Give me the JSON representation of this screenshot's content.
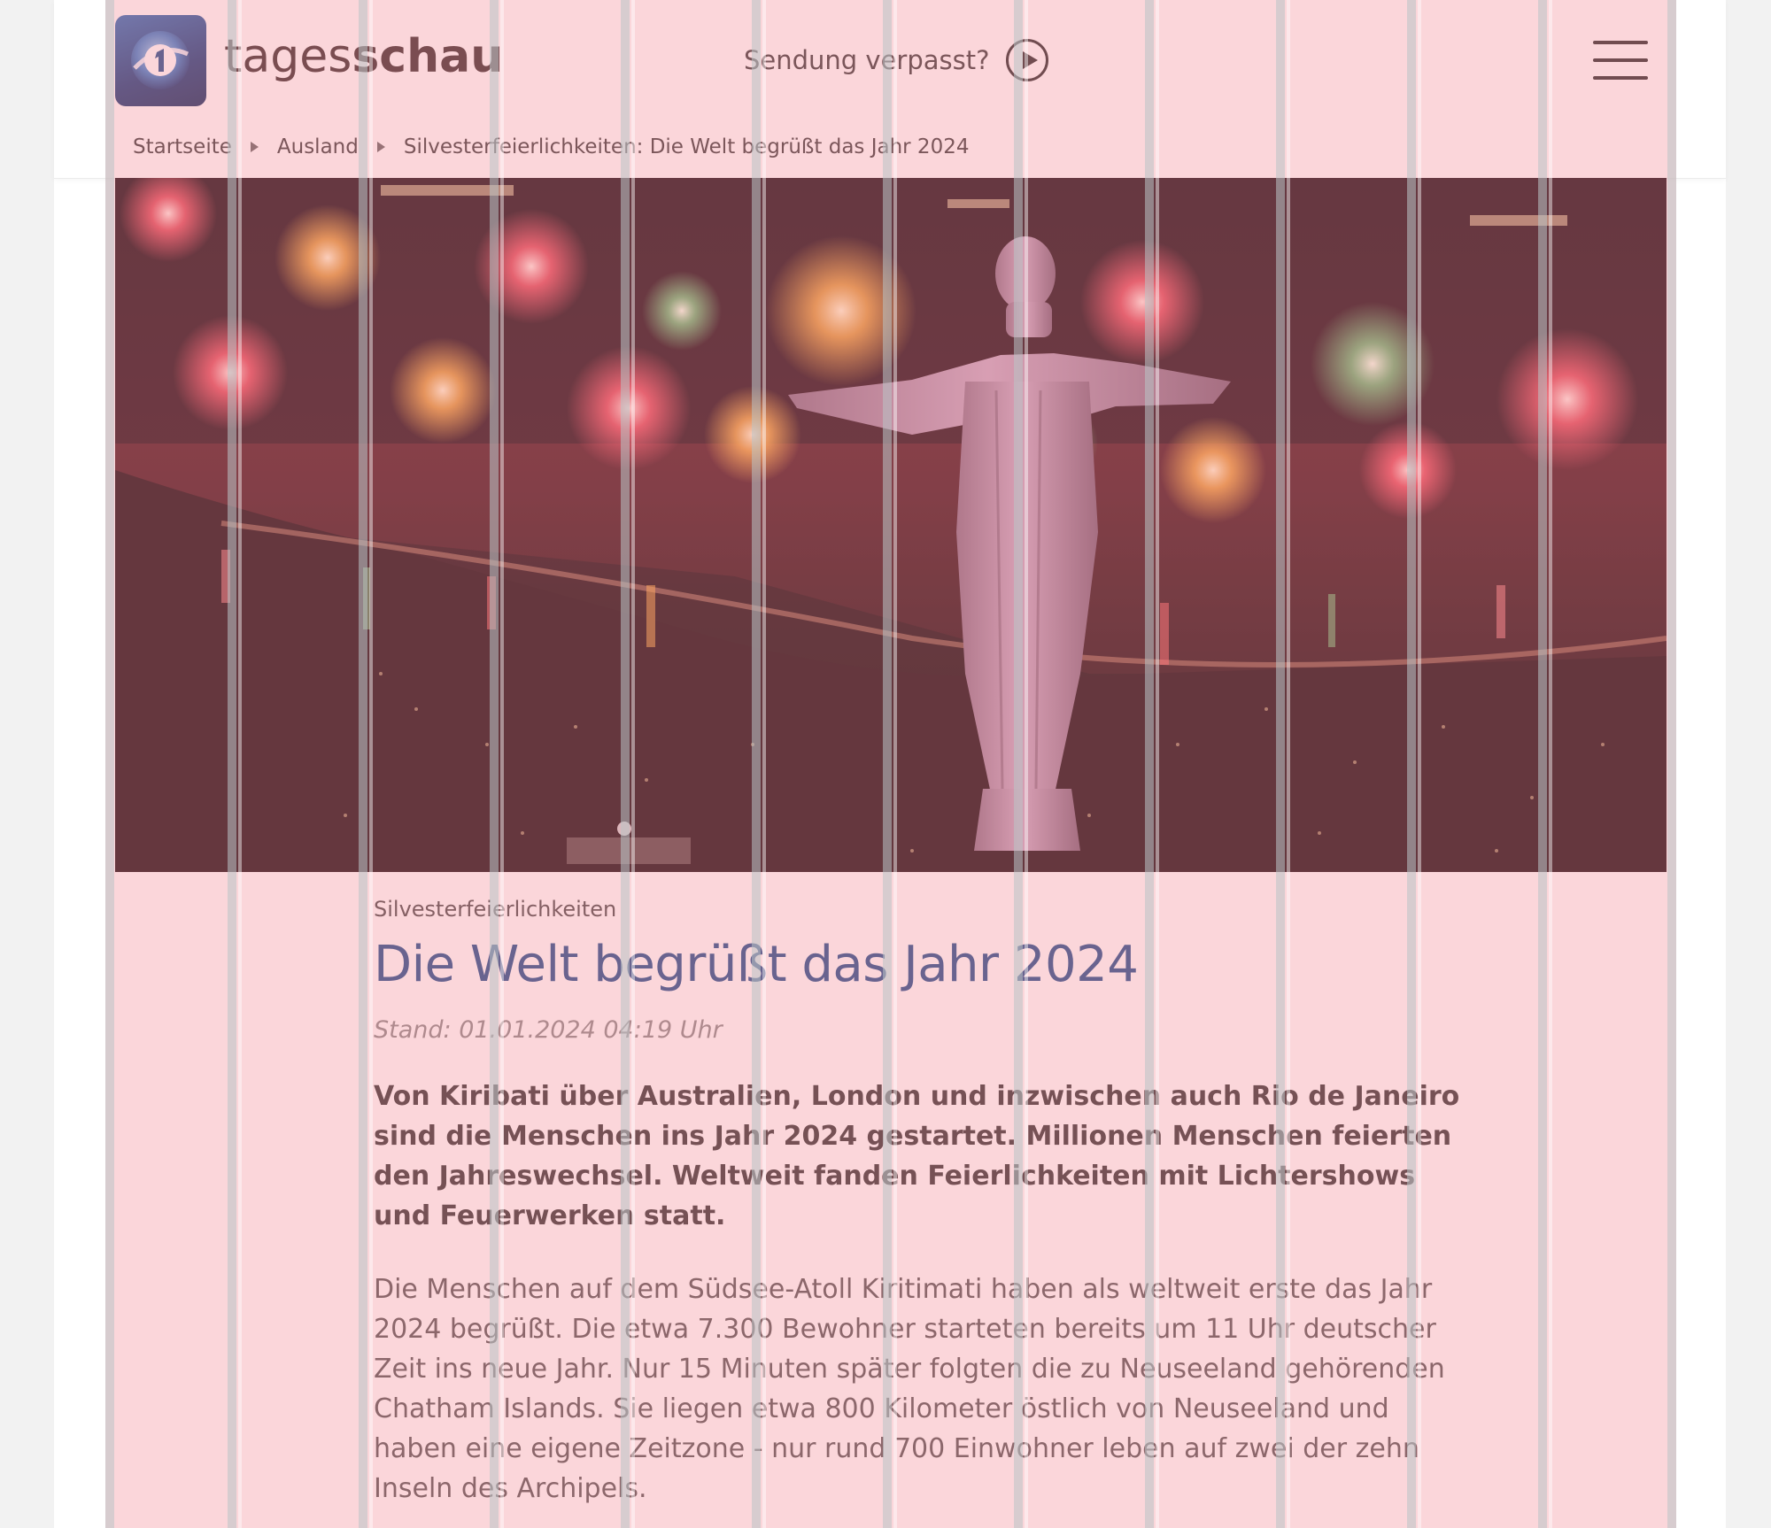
{
  "header": {
    "brand_light": "tages",
    "brand_bold": "schau",
    "missed_label": "Sendung verpasst?",
    "menu_icon": "hamburger-menu-icon",
    "play_icon": "play-circle-icon",
    "logo_icon": "ard-das-erste-logo-icon"
  },
  "breadcrumb": {
    "items": [
      "Startseite",
      "Ausland",
      "Silvesterfeierlichkeiten: Die Welt begrüßt das Jahr 2024"
    ]
  },
  "article": {
    "topline": "Silvesterfeierlichkeiten",
    "headline": "Die Welt begrüßt das Jahr 2024",
    "stand": "Stand: 01.01.2024 04:19 Uhr",
    "lead": "Von Kiribati über Australien, London und inzwischen auch Rio de Janeiro sind die Menschen ins Jahr 2024 gestartet. Millionen Menschen feierten den Jahreswechsel. Weltweit fanden Feierlichkeiten mit Lichtershows und Feuerwerken statt.",
    "body": "Die Menschen auf dem Südsee-Atoll Kiritimati haben als weltweit erste das Jahr 2024 begrüßt. Die etwa 7.300 Bewohner starteten bereits um 11 Uhr deutscher Zeit ins neue Jahr. Nur 15 Minuten später folgten die zu Neuseeland gehörenden Chatham Islands. Sie liegen etwa 800 Kilometer östlich von Neuseeland und haben eine eigene Zeitzone - nur rund 700 Einwohner leben auf zwei der zehn Inseln des Archipels."
  },
  "colors": {
    "headline": "#1f4f8c",
    "grid_overlay": "#f4a3aa",
    "brand_text": "#3a2d2d"
  }
}
